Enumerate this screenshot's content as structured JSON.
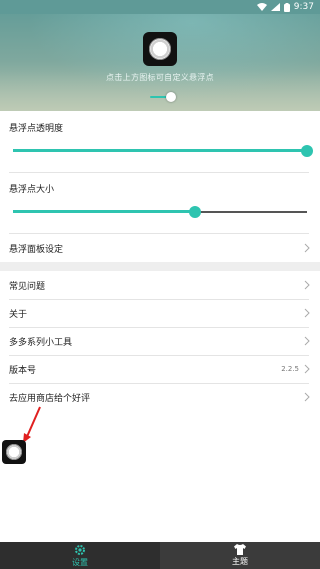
{
  "status_bar": {
    "time": "9:37"
  },
  "banner": {
    "hint": "点击上方图标可自定义悬浮点",
    "size_toggle_level": 1.0
  },
  "settings": {
    "opacity": {
      "label": "悬浮点透明度",
      "value": 1.0
    },
    "size": {
      "label": "悬浮点大小",
      "value": 0.62
    },
    "panel": {
      "label": "悬浮面板设定"
    }
  },
  "list": [
    {
      "label": "常见问题",
      "value": ""
    },
    {
      "label": "关于",
      "value": ""
    },
    {
      "label": "多多系列小工具",
      "value": ""
    },
    {
      "label": "版本号",
      "value": "2.2.5"
    },
    {
      "label": "去应用商店给个好评",
      "value": ""
    }
  ],
  "tabs": {
    "settings": "设置",
    "theme": "主题"
  },
  "colors": {
    "accent": "#2ec4b0",
    "banner_top": "#5e9a97",
    "tab_bar": "#2e2e2e",
    "annotation_arrow": "#e02020"
  }
}
